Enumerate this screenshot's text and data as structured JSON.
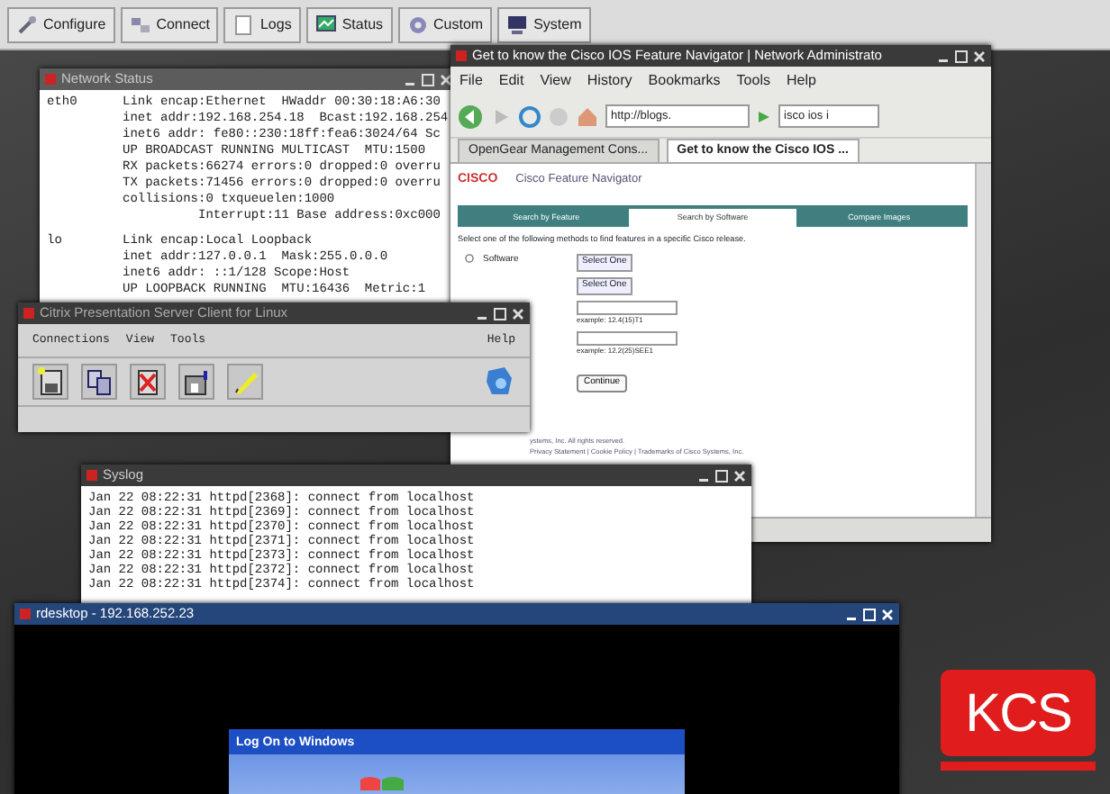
{
  "toolbar": {
    "buttons": [
      {
        "label": "Configure"
      },
      {
        "label": "Connect"
      },
      {
        "label": "Logs"
      },
      {
        "label": "Status"
      },
      {
        "label": "Custom"
      },
      {
        "label": "System"
      }
    ]
  },
  "network_status_window": {
    "title": "Network Status",
    "interfaces": [
      {
        "name": "eth0",
        "lines": [
          "Link encap:Ethernet  HWaddr 00:30:18:A6:30",
          "inet addr:192.168.254.18  Bcast:192.168.254",
          "inet6 addr: fe80::230:18ff:fea6:3024/64 Sc",
          "UP BROADCAST RUNNING MULTICAST  MTU:1500",
          "RX packets:66274 errors:0 dropped:0 overru",
          "TX packets:71456 errors:0 dropped:0 overru",
          "collisions:0 txqueuelen:1000",
          "          Interrupt:11 Base address:0xc000"
        ]
      },
      {
        "name": "lo",
        "lines": [
          "Link encap:Local Loopback",
          "inet addr:127.0.0.1  Mask:255.0.0.0",
          "inet6 addr: ::1/128 Scope:Host",
          "UP LOOPBACK RUNNING  MTU:16436  Metric:1"
        ]
      }
    ]
  },
  "browser_window": {
    "title": "Get to know the Cisco IOS Feature Navigator | Network Administrato",
    "menu": [
      "File",
      "Edit",
      "View",
      "History",
      "Bookmarks",
      "Tools",
      "Help"
    ],
    "address": "http://blogs.",
    "search": "isco ios i",
    "tabs": [
      {
        "label": "OpenGear Management Cons...",
        "selected": false
      },
      {
        "label": "Get to know the Cisco IOS ...",
        "selected": true
      }
    ],
    "page": {
      "logo": "CISCO",
      "heading": "Cisco Feature Navigator",
      "page_tabs": [
        {
          "label": "Search by Feature",
          "selected": false
        },
        {
          "label": "Search by Software",
          "selected": true
        },
        {
          "label": "Compare Images",
          "selected": false
        }
      ],
      "instruction": "Select one of the following methods to find features in a specific Cisco release.",
      "rows": [
        {
          "kind": "select",
          "label": "Software",
          "selected": false,
          "value": "Select One"
        },
        {
          "kind": "select",
          "value": "Select One"
        },
        {
          "kind": "input",
          "hint": "example: 12.4(15)T1"
        },
        {
          "kind": "input",
          "hint": "example: 12.2(25)SEE1"
        }
      ],
      "button": "Continue",
      "footer": [
        "ystems, Inc. All rights reserved.",
        "Privacy Statement | Cookie Policy | Trademarks of Cisco Systems, Inc."
      ]
    }
  },
  "citrix_window": {
    "title": "Citrix Presentation Server Client for Linux",
    "menu": [
      "Connections",
      "View",
      "Tools"
    ],
    "help_menu": "Help"
  },
  "syslog_window": {
    "title": "Syslog",
    "lines": [
      "Jan 22 08:22:31 httpd[2368]: connect from localhost",
      "Jan 22 08:22:31 httpd[2369]: connect from localhost",
      "Jan 22 08:22:31 httpd[2370]: connect from localhost",
      "Jan 22 08:22:31 httpd[2371]: connect from localhost",
      "Jan 22 08:22:31 httpd[2373]: connect from localhost",
      "Jan 22 08:22:31 httpd[2372]: connect from localhost",
      "Jan 22 08:22:31 httpd[2374]: connect from localhost"
    ]
  },
  "rdesktop_window": {
    "title": "rdesktop - 192.168.252.23",
    "dialog_title": "Log On to Windows"
  },
  "logo": {
    "text": "KCS"
  }
}
